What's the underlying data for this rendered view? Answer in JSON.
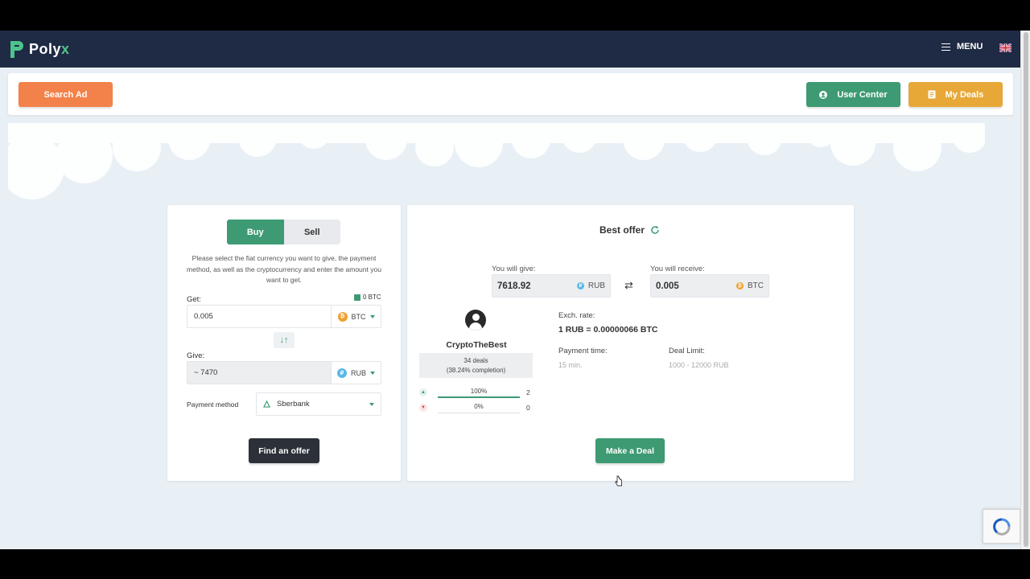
{
  "app": {
    "brand_prefix": "Poly",
    "brand_suffix": "x",
    "menu_label": "MENU"
  },
  "actions": {
    "search_label": "Search Ad",
    "user_center_label": "User Center",
    "my_deals_label": "My Deals"
  },
  "form": {
    "tabs": [
      "Buy",
      "Sell"
    ],
    "active_tab": "Buy",
    "instructions": "Please select the fiat currency you want to give, the payment method, as well as the cryptocurrency and enter the amount you want to get.",
    "get_label": "Get:",
    "balance": "0 BTC",
    "get_value": "0.005",
    "get_currency": "BTC",
    "give_label": "Give:",
    "give_value": "~ 7470",
    "give_currency": "RUB",
    "payment_label": "Payment method",
    "payment_value": "Sberbank",
    "find_label": "Find an offer"
  },
  "offer": {
    "title": "Best offer",
    "give_label": "You will give:",
    "give_amount": "7618.92",
    "give_currency": "RUB",
    "receive_label": "You will receive:",
    "receive_amount": "0.005",
    "receive_currency": "BTC",
    "user_name": "CryptoTheBest",
    "deals_count": "34 deals",
    "completion": "(38.24% completion)",
    "positive_pct": "100%",
    "positive_fraction": 1.0,
    "positive_count": "2",
    "negative_pct": "0%",
    "negative_fraction": 0.0,
    "negative_count": "0",
    "rate_label": "Exch. rate:",
    "rate_value": "1 RUB = 0.00000066 BTC",
    "payment_time_label": "Payment time:",
    "payment_time_value": "15 min.",
    "deal_limit_label": "Deal Limit:",
    "deal_limit_value": "1000 - 12000 RUB",
    "make_deal_label": "Make a Deal"
  },
  "colors": {
    "topbar": "#1f2a44",
    "primary_green": "#3d9a72",
    "orange": "#f2824a",
    "amber": "#e7a838",
    "dark_button": "#2c3139"
  }
}
